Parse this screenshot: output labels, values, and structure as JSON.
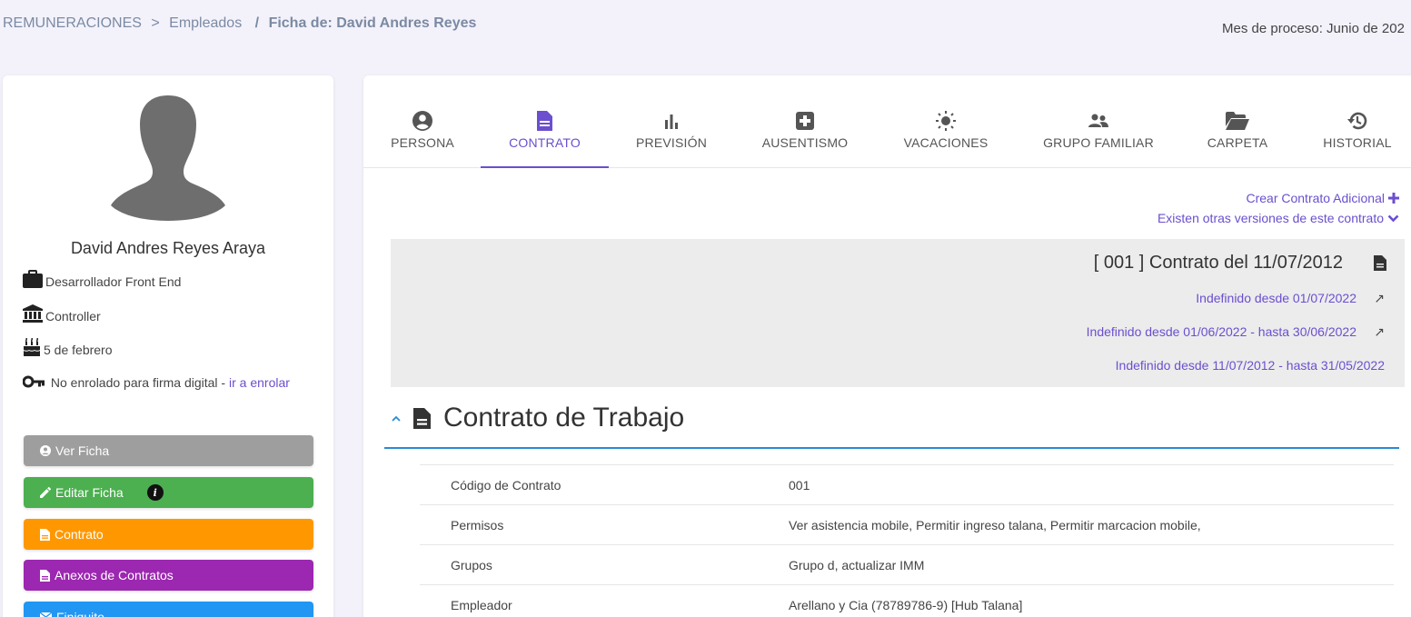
{
  "breadcrumb": {
    "root": "REMUNERACIONES",
    "sep1": ">",
    "section": "Empleados",
    "sep2": "/",
    "current": "Ficha de: David Andres Reyes"
  },
  "process_month": "Mes de proceso: Junio de 202",
  "profile": {
    "name": "David Andres Reyes Araya",
    "position": "Desarrollador Front End",
    "department": "Controller",
    "birthday": "5 de febrero",
    "signature_status": "No enrolado para firma digital -",
    "enroll_link": "ir a enrolar"
  },
  "actions": {
    "view": "Ver Ficha",
    "edit": "Editar Ficha",
    "contract": "Contrato",
    "annexes": "Anexos de Contratos",
    "settlement": "Finiquito",
    "info_badge": "i"
  },
  "tabs": [
    {
      "label": "PERSONA",
      "icon": "user-circle-icon"
    },
    {
      "label": "CONTRATO",
      "icon": "document-icon"
    },
    {
      "label": "PREVISIÓN",
      "icon": "bar-chart-icon"
    },
    {
      "label": "AUSENTISMO",
      "icon": "medical-cross-icon"
    },
    {
      "label": "VACACIONES",
      "icon": "sun-icon"
    },
    {
      "label": "GRUPO FAMILIAR",
      "icon": "people-icon"
    },
    {
      "label": "CARPETA",
      "icon": "folder-open-icon"
    },
    {
      "label": "HISTORIAL",
      "icon": "history-icon"
    }
  ],
  "contract": {
    "create_additional": "Crear Contrato Adicional",
    "other_versions": "Existen otras versiones de este contrato",
    "title": "[ 001 ] Contrato del 11/07/2012",
    "versions": [
      "Indefinido desde 01/07/2022",
      "Indefinido desde 01/06/2022 - hasta 30/06/2022",
      "Indefinido desde 11/07/2012 - hasta 31/05/2022"
    ],
    "arrow": "↗",
    "section_title": "Contrato de Trabajo"
  },
  "details": [
    {
      "label": "Código de Contrato",
      "value": "001"
    },
    {
      "label": "Permisos",
      "value": "Ver asistencia mobile, Permitir ingreso talana, Permitir marcacion mobile,"
    },
    {
      "label": "Grupos",
      "value": "Grupo d, actualizar IMM"
    },
    {
      "label": "Empleador",
      "value": "Arellano y Cia (78789786-9) [Hub Talana]"
    }
  ],
  "colors": {
    "accent": "#6b4fcf",
    "btn_view": "#9e9e9e",
    "btn_edit": "#4caf50",
    "btn_contract": "#ff9800",
    "btn_annexes": "#9c27b0",
    "btn_settlement": "#2196f3",
    "section_rule": "#2a8bd6"
  }
}
